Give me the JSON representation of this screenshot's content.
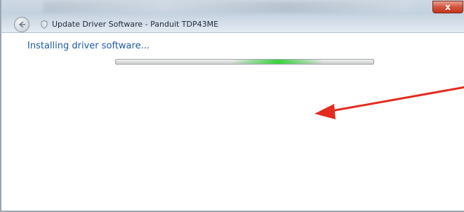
{
  "window": {
    "title": "Update Driver Software - Panduit TDP43ME",
    "close_label": "x"
  },
  "content": {
    "heading": "Installing driver software..."
  },
  "progress": {
    "state": "indeterminate",
    "glow_center_fraction": 0.63,
    "color": "#37d23c"
  },
  "annotation": {
    "color": "#e32b20"
  },
  "icons": {
    "back": "back-arrow-icon",
    "title": "shield-icon"
  }
}
